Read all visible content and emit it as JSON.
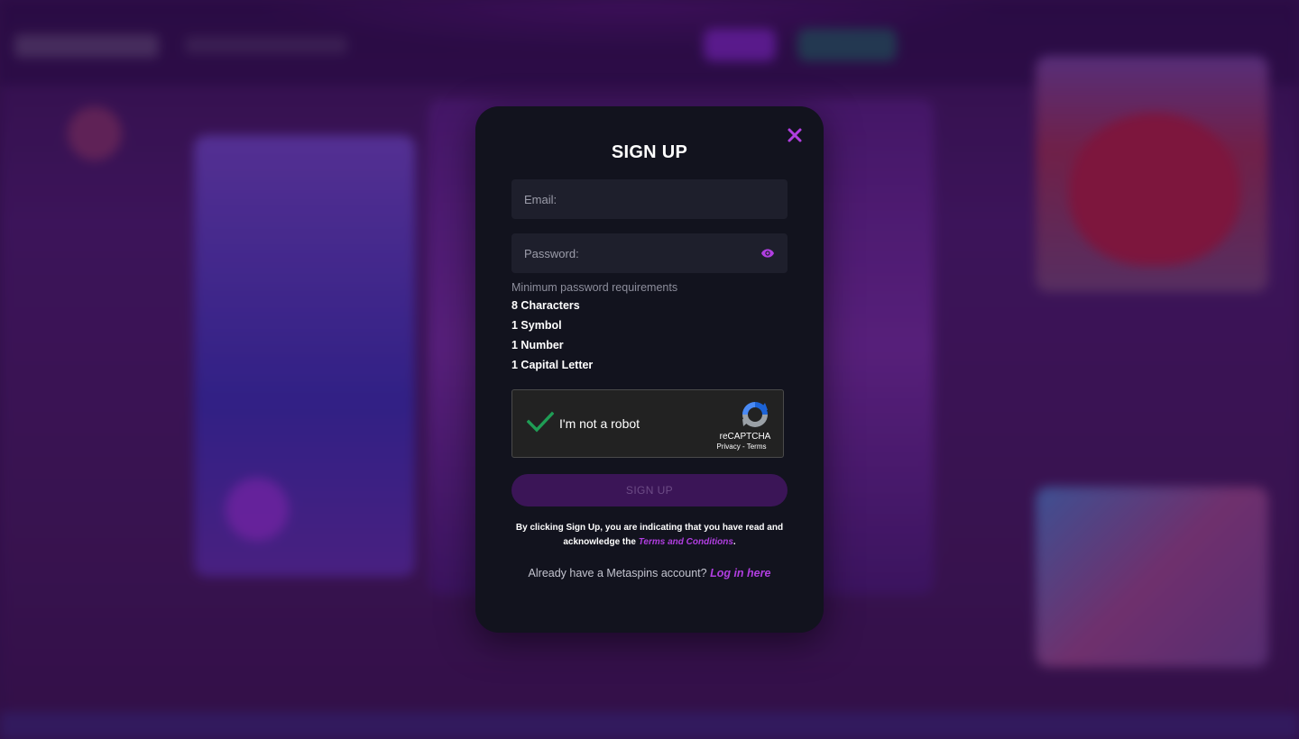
{
  "modal": {
    "title": "SIGN UP",
    "close_icon": "close-icon",
    "email_placeholder": "Email:",
    "password_placeholder": "Password:",
    "password_toggle_icon": "eye-icon",
    "requirements_title": "Minimum password requirements",
    "requirements": [
      "8 Characters",
      "1 Symbol",
      "1 Number",
      "1 Capital Letter"
    ],
    "captcha": {
      "label": "I'm not a robot",
      "checked": true,
      "brand": "reCAPTCHA",
      "links": "Privacy - Terms"
    },
    "submit_label": "SIGN UP",
    "terms_text_before": "By clicking Sign Up, you are indicating that you have read and acknowledge the ",
    "terms_link": "Terms and Conditions",
    "terms_text_after": ".",
    "login_prompt": "Already have a Metaspins account?",
    "login_link": "Log in here"
  },
  "colors": {
    "accent": "#b03ee0",
    "modal_bg": "#12131e",
    "field_bg": "#1e1f2c",
    "button_disabled": "#3b1557",
    "check_green": "#1f9d55"
  }
}
